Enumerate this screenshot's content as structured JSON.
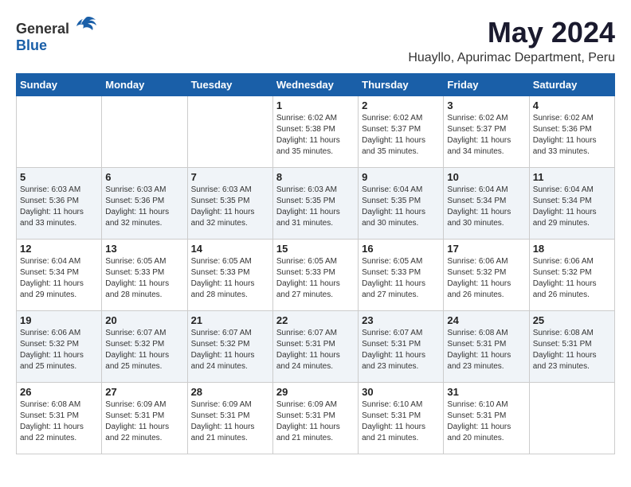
{
  "logo": {
    "general": "General",
    "blue": "Blue"
  },
  "title": "May 2024",
  "subtitle": "Huayllo, Apurimac Department, Peru",
  "days_of_week": [
    "Sunday",
    "Monday",
    "Tuesday",
    "Wednesday",
    "Thursday",
    "Friday",
    "Saturday"
  ],
  "weeks": [
    [
      {
        "day": "",
        "info": ""
      },
      {
        "day": "",
        "info": ""
      },
      {
        "day": "",
        "info": ""
      },
      {
        "day": "1",
        "info": "Sunrise: 6:02 AM\nSunset: 5:38 PM\nDaylight: 11 hours and 35 minutes."
      },
      {
        "day": "2",
        "info": "Sunrise: 6:02 AM\nSunset: 5:37 PM\nDaylight: 11 hours and 35 minutes."
      },
      {
        "day": "3",
        "info": "Sunrise: 6:02 AM\nSunset: 5:37 PM\nDaylight: 11 hours and 34 minutes."
      },
      {
        "day": "4",
        "info": "Sunrise: 6:02 AM\nSunset: 5:36 PM\nDaylight: 11 hours and 33 minutes."
      }
    ],
    [
      {
        "day": "5",
        "info": "Sunrise: 6:03 AM\nSunset: 5:36 PM\nDaylight: 11 hours and 33 minutes."
      },
      {
        "day": "6",
        "info": "Sunrise: 6:03 AM\nSunset: 5:36 PM\nDaylight: 11 hours and 32 minutes."
      },
      {
        "day": "7",
        "info": "Sunrise: 6:03 AM\nSunset: 5:35 PM\nDaylight: 11 hours and 32 minutes."
      },
      {
        "day": "8",
        "info": "Sunrise: 6:03 AM\nSunset: 5:35 PM\nDaylight: 11 hours and 31 minutes."
      },
      {
        "day": "9",
        "info": "Sunrise: 6:04 AM\nSunset: 5:35 PM\nDaylight: 11 hours and 30 minutes."
      },
      {
        "day": "10",
        "info": "Sunrise: 6:04 AM\nSunset: 5:34 PM\nDaylight: 11 hours and 30 minutes."
      },
      {
        "day": "11",
        "info": "Sunrise: 6:04 AM\nSunset: 5:34 PM\nDaylight: 11 hours and 29 minutes."
      }
    ],
    [
      {
        "day": "12",
        "info": "Sunrise: 6:04 AM\nSunset: 5:34 PM\nDaylight: 11 hours and 29 minutes."
      },
      {
        "day": "13",
        "info": "Sunrise: 6:05 AM\nSunset: 5:33 PM\nDaylight: 11 hours and 28 minutes."
      },
      {
        "day": "14",
        "info": "Sunrise: 6:05 AM\nSunset: 5:33 PM\nDaylight: 11 hours and 28 minutes."
      },
      {
        "day": "15",
        "info": "Sunrise: 6:05 AM\nSunset: 5:33 PM\nDaylight: 11 hours and 27 minutes."
      },
      {
        "day": "16",
        "info": "Sunrise: 6:05 AM\nSunset: 5:33 PM\nDaylight: 11 hours and 27 minutes."
      },
      {
        "day": "17",
        "info": "Sunrise: 6:06 AM\nSunset: 5:32 PM\nDaylight: 11 hours and 26 minutes."
      },
      {
        "day": "18",
        "info": "Sunrise: 6:06 AM\nSunset: 5:32 PM\nDaylight: 11 hours and 26 minutes."
      }
    ],
    [
      {
        "day": "19",
        "info": "Sunrise: 6:06 AM\nSunset: 5:32 PM\nDaylight: 11 hours and 25 minutes."
      },
      {
        "day": "20",
        "info": "Sunrise: 6:07 AM\nSunset: 5:32 PM\nDaylight: 11 hours and 25 minutes."
      },
      {
        "day": "21",
        "info": "Sunrise: 6:07 AM\nSunset: 5:32 PM\nDaylight: 11 hours and 24 minutes."
      },
      {
        "day": "22",
        "info": "Sunrise: 6:07 AM\nSunset: 5:31 PM\nDaylight: 11 hours and 24 minutes."
      },
      {
        "day": "23",
        "info": "Sunrise: 6:07 AM\nSunset: 5:31 PM\nDaylight: 11 hours and 23 minutes."
      },
      {
        "day": "24",
        "info": "Sunrise: 6:08 AM\nSunset: 5:31 PM\nDaylight: 11 hours and 23 minutes."
      },
      {
        "day": "25",
        "info": "Sunrise: 6:08 AM\nSunset: 5:31 PM\nDaylight: 11 hours and 23 minutes."
      }
    ],
    [
      {
        "day": "26",
        "info": "Sunrise: 6:08 AM\nSunset: 5:31 PM\nDaylight: 11 hours and 22 minutes."
      },
      {
        "day": "27",
        "info": "Sunrise: 6:09 AM\nSunset: 5:31 PM\nDaylight: 11 hours and 22 minutes."
      },
      {
        "day": "28",
        "info": "Sunrise: 6:09 AM\nSunset: 5:31 PM\nDaylight: 11 hours and 21 minutes."
      },
      {
        "day": "29",
        "info": "Sunrise: 6:09 AM\nSunset: 5:31 PM\nDaylight: 11 hours and 21 minutes."
      },
      {
        "day": "30",
        "info": "Sunrise: 6:10 AM\nSunset: 5:31 PM\nDaylight: 11 hours and 21 minutes."
      },
      {
        "day": "31",
        "info": "Sunrise: 6:10 AM\nSunset: 5:31 PM\nDaylight: 11 hours and 20 minutes."
      },
      {
        "day": "",
        "info": ""
      }
    ]
  ],
  "row_classes": [
    "row-white",
    "row-shaded",
    "row-white",
    "row-shaded",
    "row-white"
  ]
}
